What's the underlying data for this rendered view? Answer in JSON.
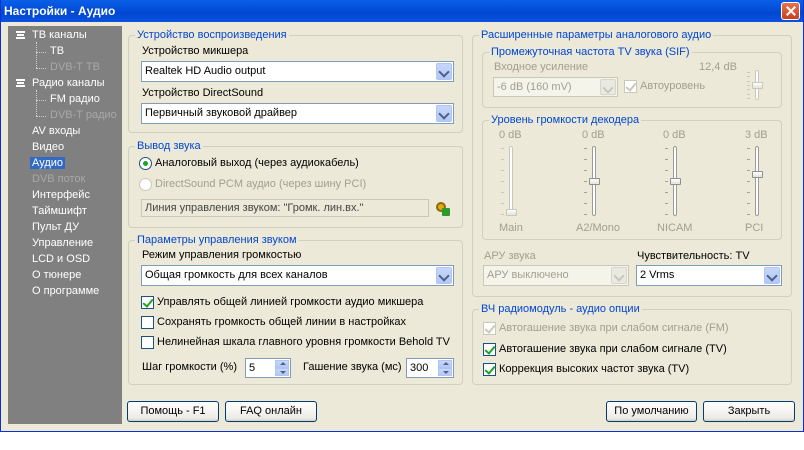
{
  "window": {
    "title": "Настройки - Аудио"
  },
  "sidebar": {
    "items": [
      {
        "label": "ТВ каналы",
        "level": 0,
        "expander": true
      },
      {
        "label": "ТВ",
        "level": 1
      },
      {
        "label": "DVB-T ТВ",
        "level": 1,
        "disabled": true
      },
      {
        "label": "Радио каналы",
        "level": 0,
        "expander": true
      },
      {
        "label": "FM радио",
        "level": 1
      },
      {
        "label": "DVB-T радио",
        "level": 1,
        "disabled": true
      },
      {
        "label": "AV входы",
        "level": 0
      },
      {
        "label": "Видео",
        "level": 0
      },
      {
        "label": "Аудио",
        "level": 0,
        "selected": true
      },
      {
        "label": "DVB поток",
        "level": 0,
        "disabled": true
      },
      {
        "label": "Интерфейс",
        "level": 0
      },
      {
        "label": "Таймшифт",
        "level": 0
      },
      {
        "label": "Пульт ДУ",
        "level": 0
      },
      {
        "label": "Управление",
        "level": 0
      },
      {
        "label": "LCD и OSD",
        "level": 0
      },
      {
        "label": "О тюнере",
        "level": 0
      },
      {
        "label": "О программе",
        "level": 0
      }
    ]
  },
  "playback": {
    "title": "Устройство воспроизведения",
    "mixer_label": "Устройство микшера",
    "mixer_value": "Realtek HD Audio output",
    "ds_label": "Устройство DirectSound",
    "ds_value": "Первичный звуковой драйвер"
  },
  "output": {
    "title": "Вывод звука",
    "analog_label": "Аналоговый выход (через аудиокабель)",
    "pcm_label": "DirectSound PCM аудио (через шину PCI)",
    "line_text": "Линия управления звуком: \"Громк. лин.вх.\""
  },
  "control": {
    "title": "Параметры управления звуком",
    "mode_label": "Режим управления громкостью",
    "mode_value": "Общая громкость для всех каналов",
    "opt1": "Управлять общей линией громкости аудио микшера",
    "opt2": "Сохранять громкость общей линии в настройках",
    "opt3": "Нелинейная шкала главного уровня громкости Behold TV",
    "step_label": "Шаг громкости (%)",
    "step_value": "5",
    "fade_label": "Гашение звука (мс)",
    "fade_value": "300"
  },
  "analog": {
    "title": "Расширенные параметры аналогового аудио",
    "sif": {
      "title": "Промежуточная частота TV звука (SIF)",
      "gain_label": "Входное усиление",
      "gain_value": "-6 dB (160 mV)",
      "auto_label": "Автоуровень",
      "db_value": "12,4 dB",
      "slider_level": 0.5
    },
    "decoder": {
      "title": "Уровень громкости декодера",
      "sliders": [
        {
          "name": "Main",
          "db": "0 dB",
          "level": 0.0
        },
        {
          "name": "A2/Mono",
          "db": "0 dB",
          "level": 0.5
        },
        {
          "name": "NICAM",
          "db": "0 dB",
          "level": 0.5
        },
        {
          "name": "PCI",
          "db": "3 dB",
          "level": 0.6
        }
      ]
    },
    "agc_label": "АРУ звука",
    "agc_value": "АРУ выключено",
    "sens_label": "Чувствительность: TV",
    "sens_value": "2 Vrms"
  },
  "rf": {
    "title": "ВЧ радиомодуль - аудио опции",
    "opt1": "Автогашение звука при слабом сигнале (FM)",
    "opt2": "Автогашение звука при слабом сигнале (TV)",
    "opt3": "Коррекция высоких частот звука (TV)"
  },
  "buttons": {
    "help": "Помощь - F1",
    "faq": "FAQ онлайн",
    "default": "По умолчанию",
    "close": "Закрыть"
  }
}
